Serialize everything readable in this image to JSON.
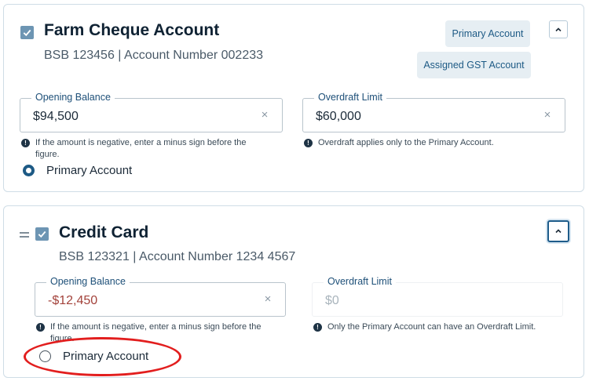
{
  "accounts": [
    {
      "title": "Farm Cheque Account",
      "subtitle": "BSB 123456 | Account Number 002233",
      "badges": [
        "Primary Account",
        "Assigned GST Account"
      ],
      "opening_balance": {
        "label": "Opening Balance",
        "value": "$94,500",
        "helper": "If the amount is negative, enter a minus sign before the figure."
      },
      "overdraft_limit": {
        "label": "Overdraft Limit",
        "value": "$60,000",
        "helper": "Overdraft applies only to the Primary Account."
      },
      "primary_radio_label": "Primary Account",
      "primary_selected": true
    },
    {
      "title": "Credit Card",
      "subtitle": "BSB 123321 | Account Number 1234 4567",
      "opening_balance": {
        "label": "Opening Balance",
        "value": "-$12,450",
        "helper": "If the amount is negative, enter a minus sign before the figure."
      },
      "overdraft_limit": {
        "label": "Overdraft Limit",
        "placeholder": "$0",
        "helper": "Only the Primary Account can have an Overdraft Limit."
      },
      "primary_radio_label": "Primary Account",
      "primary_selected": false
    }
  ],
  "icons": {
    "check": "check-icon",
    "clear": "×",
    "collapse": "chevron-up-icon",
    "info": "!",
    "drag": "drag-handle-icon"
  },
  "colors": {
    "accent": "#1d5a85",
    "negative": "#a3423b",
    "annotation": "#e21e1e"
  }
}
